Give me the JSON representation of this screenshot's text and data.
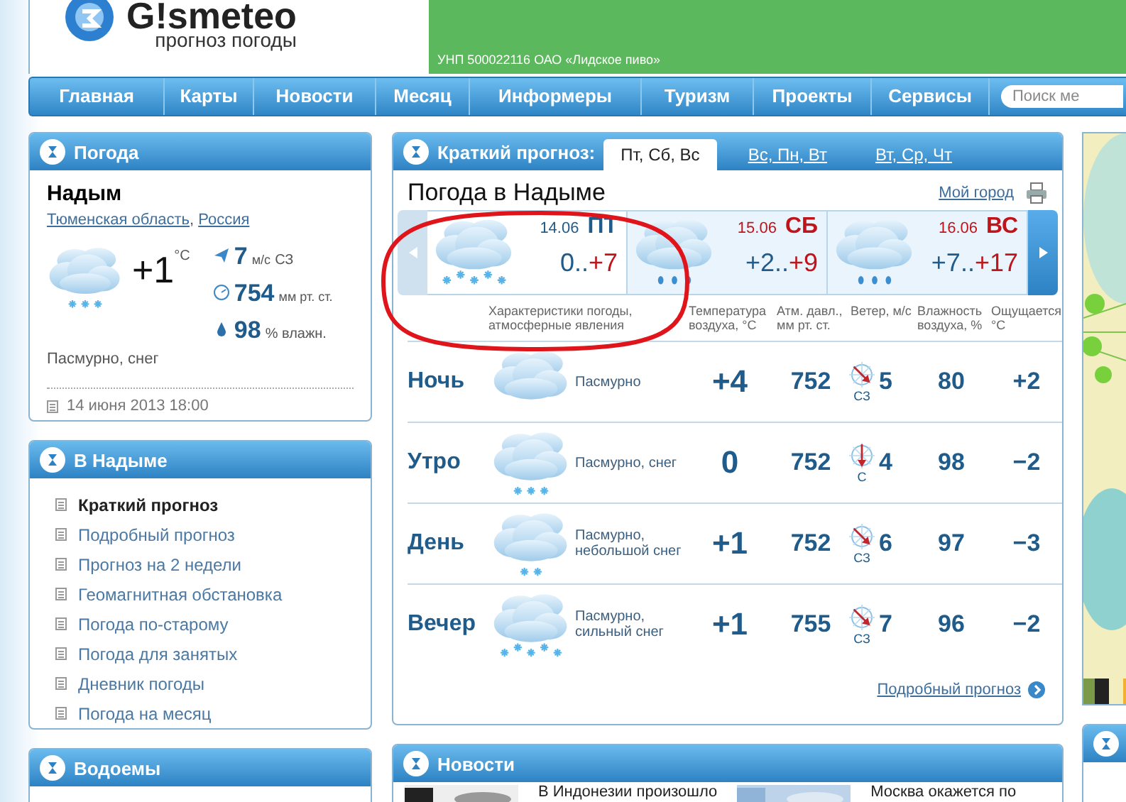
{
  "header": {
    "logo": "G!smeteo",
    "tagline": "прогноз погоды",
    "banner_text": "УНП 500022116 ОАО «Лидское пиво»"
  },
  "nav": {
    "items": [
      "Главная",
      "Карты",
      "Новости",
      "Месяц",
      "Информеры",
      "Туризм",
      "Проекты",
      "Сервисы"
    ],
    "search": {
      "placeholder": "Поиск ме"
    }
  },
  "weather_panel": {
    "title": "Погода",
    "city": "Надым",
    "region": "Тюменская область",
    "separator": ",",
    "country": "Россия",
    "icon": {
      "kind": "snow"
    },
    "temp": "+1",
    "temp_unit": "°C",
    "wind_speed": "7",
    "wind_unit": "м/с",
    "wind_dir": "СЗ",
    "pressure": "754",
    "pressure_unit": "мм рт. ст.",
    "humidity": "98",
    "humidity_unit": "% влажн.",
    "condition": "Пасмурно, снег",
    "updated": "14 июня 2013 18:00"
  },
  "city_panel": {
    "title": "В Надыме",
    "items": [
      {
        "label": "Краткий прогноз",
        "selected": true
      },
      {
        "label": "Подробный прогноз",
        "selected": false
      },
      {
        "label": "Прогноз на 2 недели",
        "selected": false
      },
      {
        "label": "Геомагнитная обстановка",
        "selected": false
      },
      {
        "label": "Погода по-старому",
        "selected": false
      },
      {
        "label": "Погода для занятых",
        "selected": false
      },
      {
        "label": "Дневник погоды",
        "selected": false
      },
      {
        "label": "Погода на месяц",
        "selected": false
      }
    ]
  },
  "water_panel": {
    "title": "Водоемы"
  },
  "forecast": {
    "label": "Краткий прогноз:",
    "tabs": [
      {
        "label": "Пт, Сб, Вс",
        "selected": true
      },
      {
        "label": "Вс, Пн, Вт",
        "selected": false
      },
      {
        "label": "Вт, Ср, Чт",
        "selected": false
      }
    ],
    "title": "Погода в Надыме",
    "my_city": "Мой город",
    "days": [
      {
        "date": "14.06",
        "day": "ПТ",
        "low": "0..",
        "high": "+7",
        "icon": {
          "kind": "heavy_snow"
        },
        "weekend": false,
        "selected": true
      },
      {
        "date": "15.06",
        "day": "СБ",
        "low": "+2..",
        "high": "+9",
        "icon": {
          "kind": "rain"
        },
        "weekend": true,
        "selected": false
      },
      {
        "date": "16.06",
        "day": "ВС",
        "low": "+7..",
        "high": "+17",
        "icon": {
          "kind": "rain"
        },
        "weekend": true,
        "selected": false
      }
    ],
    "columns": [
      "Характеристики погоды, атмосферные явления",
      "Температура воздуха, °С",
      "Атм. давл., мм рт. ст.",
      "Ветер, м/с",
      "Влажность воздуха, %",
      "Ощущается, °С"
    ],
    "rows": [
      {
        "period": "Ночь",
        "icon": {
          "kind": "none"
        },
        "condition": "Пасмурно",
        "temp": "+4",
        "pressure": "752",
        "wind": {
          "kind": "nw",
          "dir": "СЗ",
          "speed": "5"
        },
        "humidity": "80",
        "feels": "+2"
      },
      {
        "period": "Утро",
        "icon": {
          "kind": "snow"
        },
        "condition": "Пасмурно, снег",
        "temp": "0",
        "pressure": "752",
        "wind": {
          "kind": "n",
          "dir": "С",
          "speed": "4"
        },
        "humidity": "98",
        "feels": "−2"
      },
      {
        "period": "День",
        "icon": {
          "kind": "light_snow"
        },
        "condition": "Пасмурно, небольшой снег",
        "temp": "+1",
        "pressure": "752",
        "wind": {
          "kind": "nw",
          "dir": "СЗ",
          "speed": "6"
        },
        "humidity": "97",
        "feels": "−3"
      },
      {
        "period": "Вечер",
        "icon": {
          "kind": "heavy_snow"
        },
        "condition": "Пасмурно, сильный снег",
        "temp": "+1",
        "pressure": "755",
        "wind": {
          "kind": "nw",
          "dir": "СЗ",
          "speed": "7"
        },
        "humidity": "96",
        "feels": "−2"
      }
    ],
    "more_link": "Подробный прогноз"
  },
  "news_panel": {
    "title": "Новости",
    "items": [
      "В Индонезии произошло",
      "Москва окажется по"
    ]
  }
}
